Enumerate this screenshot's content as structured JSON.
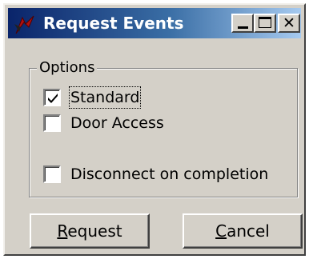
{
  "window": {
    "title": "Request Events",
    "icon": "red-arrow-app-icon",
    "controls": [
      "minimize",
      "maximize",
      "close"
    ]
  },
  "options": {
    "label": "Options",
    "checkboxes": [
      {
        "label": "Standard",
        "checked": true,
        "focused": true
      },
      {
        "label": "Door Access",
        "checked": false
      },
      {
        "label": "Disconnect on completion",
        "checked": false
      }
    ]
  },
  "buttons": {
    "request": {
      "mnemonic": "R",
      "rest": "equest"
    },
    "cancel": {
      "mnemonic": "C",
      "rest": "ancel"
    }
  },
  "colors": {
    "title_bar_start": "#0a246a",
    "title_bar_end": "#a6caf0",
    "face": "#d4d0c8"
  }
}
